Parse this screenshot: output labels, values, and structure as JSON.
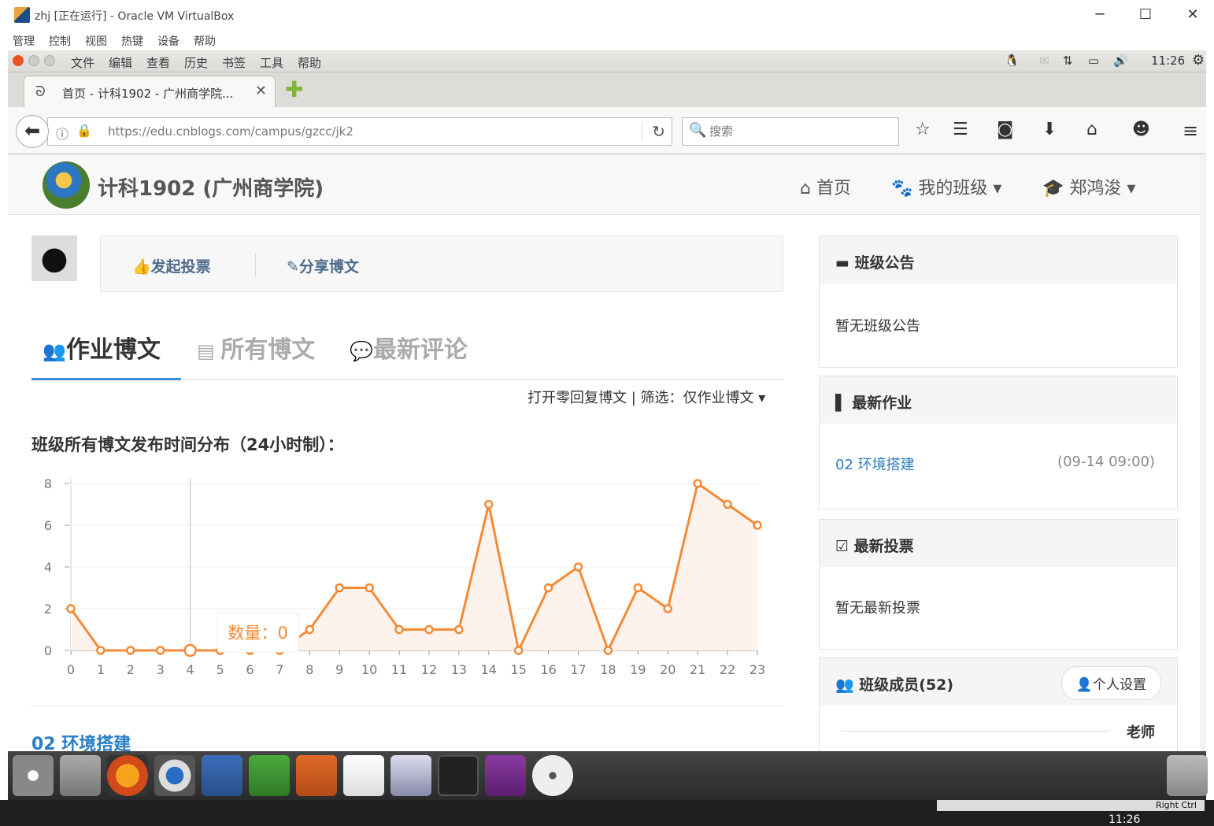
{
  "host_window": {
    "title": "zhj [正在运行] - Oracle VM VirtualBox",
    "menu": [
      "管理",
      "控制",
      "视图",
      "热键",
      "设备",
      "帮助"
    ],
    "controls": [
      "─",
      "☐",
      "✕"
    ]
  },
  "guest_panel": {
    "menu": [
      "文件",
      "编辑",
      "查看",
      "历史",
      "书签",
      "工具",
      "帮助"
    ],
    "time": "11:26"
  },
  "browser": {
    "tab_title": "首页 - 计科1902 - 广州商学院...",
    "tab_close": "✕",
    "url": "https://edu.cnblogs.com/campus/gzcc/jk2",
    "search_placeholder": "搜索"
  },
  "site": {
    "title": "计科1902 (广州商学院)",
    "nav": {
      "home": "首页",
      "my_class": "我的班级",
      "user": "郑鸿浚"
    }
  },
  "actions": {
    "vote": "发起投票",
    "share": "分享博文"
  },
  "tabs": {
    "homework": "作业博文",
    "all": "所有博文",
    "comments": "最新评论"
  },
  "filter": "打开零回复博文 | 筛选：仅作业博文",
  "chart_title": "班级所有博文发布时间分布（24小时制）：",
  "chart_data": {
    "type": "line",
    "title": "班级所有博文发布时间分布（24小时制）：",
    "x": [
      0,
      1,
      2,
      3,
      4,
      5,
      6,
      7,
      8,
      9,
      10,
      11,
      12,
      13,
      14,
      15,
      16,
      17,
      18,
      19,
      20,
      21,
      22,
      23
    ],
    "series": [
      {
        "values": [
          2,
          0,
          0,
          0,
          0,
          0,
          0,
          0,
          1,
          3,
          3,
          1,
          1,
          1,
          7,
          0,
          3,
          4,
          0,
          3,
          2,
          8,
          7,
          6
        ]
      }
    ],
    "ylim": [
      0,
      8
    ],
    "yticks": [
      0,
      2,
      4,
      6,
      8
    ],
    "grid": true,
    "tooltip": {
      "label": "数量：",
      "value": "0",
      "hover_index": 4
    }
  },
  "first_post": "02 环境搭建",
  "sidebar": {
    "announce": {
      "title": "班级公告",
      "body": "暂无班级公告"
    },
    "homework": {
      "title": "最新作业",
      "item": "02 环境搭建",
      "date": "(09-14 09:00)"
    },
    "vote": {
      "title": "最新投票",
      "body": "暂无最新投票"
    },
    "members": {
      "title": "班级成员(52)",
      "settings": "个人设置",
      "teacher": "老师"
    }
  },
  "host_taskbar": {
    "time": "11:26",
    "vbox_status": "Right Ctrl"
  },
  "colors": {
    "accent": "#3b8fd6",
    "line": "#f58a36",
    "fill": "#fdf3ec"
  }
}
